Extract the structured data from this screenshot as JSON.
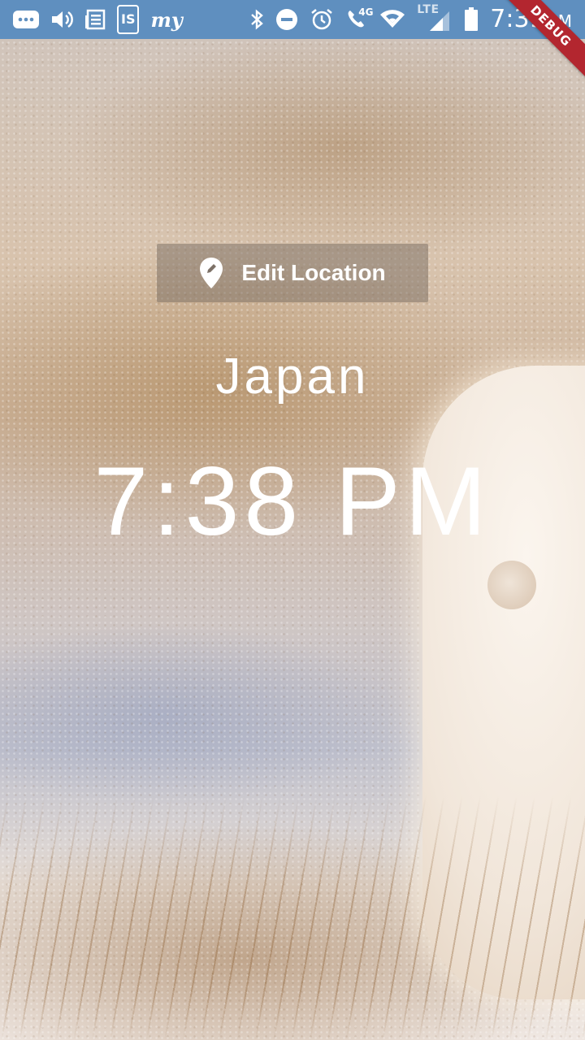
{
  "status_bar": {
    "icons": [
      "more-icon",
      "volume-icon",
      "news-icon",
      "is-app-icon",
      "my-app-icon",
      "bluetooth-icon",
      "do-not-disturb-icon",
      "alarm-icon",
      "call-4g-icon",
      "wifi-icon",
      "lte-signal-icon",
      "battery-icon"
    ],
    "is_label": "IS",
    "my_label": "my",
    "call_label": "4G",
    "lte_label": "LTE",
    "time": "7:39",
    "ampm": "PM",
    "background_color": "#5f8fbf"
  },
  "debug_banner": "DEBUG",
  "edit_location": {
    "label": "Edit Location",
    "icon": "edit-location-icon"
  },
  "location": "Japan",
  "time": "7:38 PM"
}
